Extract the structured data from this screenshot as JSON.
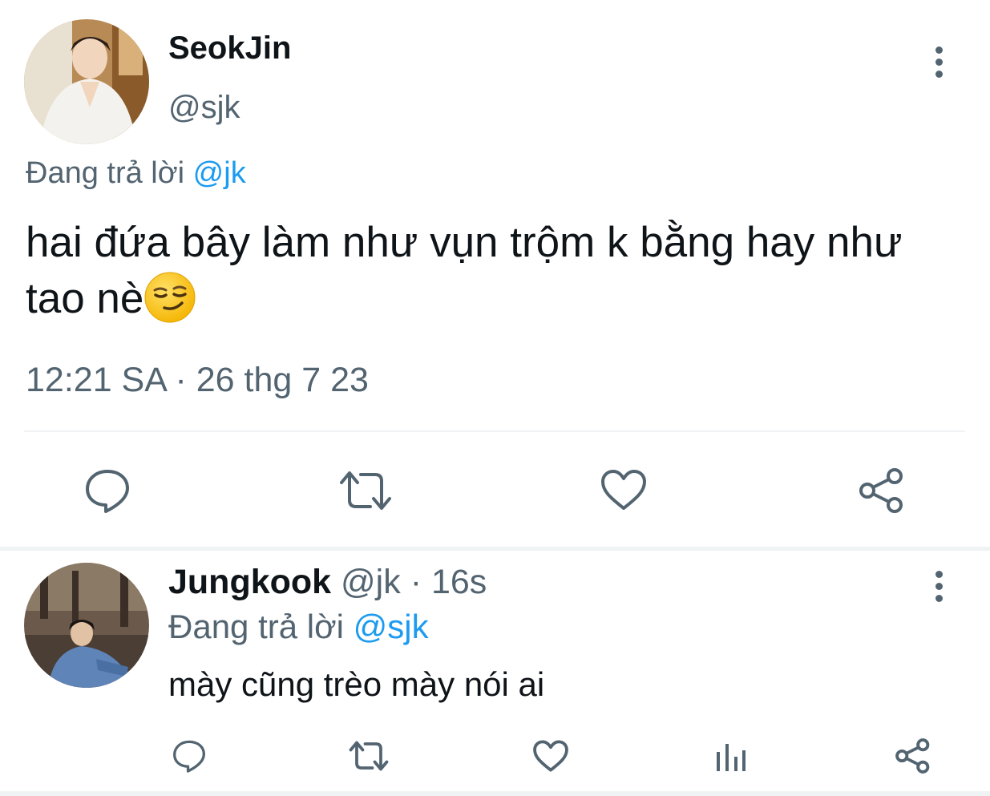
{
  "main_tweet": {
    "display_name": "SeokJin",
    "handle": "@sjk",
    "replying_prefix": "Đang trả lời ",
    "replying_to": "@jk",
    "text": "hai đứa bây làm như vụn trộm k bằng hay như tao nè",
    "emoji": "smirking-face",
    "timestamp": "12:21 SA · 26 thg 7 23",
    "actions": [
      "reply",
      "retweet",
      "like",
      "share"
    ]
  },
  "reply_tweet": {
    "display_name": "Jungkook",
    "handle": "@jk",
    "separator": " · ",
    "time_ago": "16s",
    "replying_prefix": "Đang trả lời ",
    "replying_to": "@sjk",
    "text": "mày cũng trèo mày nói ai",
    "actions": [
      "reply",
      "retweet",
      "like",
      "views",
      "share"
    ]
  },
  "colors": {
    "text_primary": "#0f1419",
    "text_secondary": "#536471",
    "accent": "#1d9bf0",
    "divider": "#eff3f4"
  }
}
